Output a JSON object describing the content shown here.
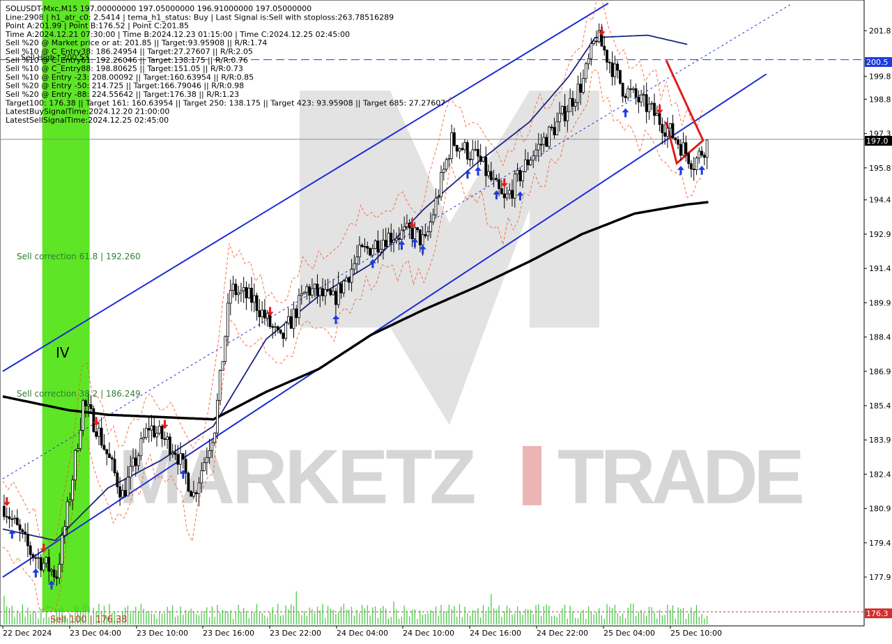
{
  "header": {
    "lines": [
      "SOLUSDT-Mxc,M15  197.00000000 197.05000000 196.91000000 197.05000000",
      "Line:2908 | h1_atr_c0: 2.5414 | tema_h1_status: Buy | Last Signal is:Sell with stoploss:263.78516289",
      "Point A:201.99 | Point B:176.52 | Point C:201.85",
      "Time A:2024.12.21 07:30:00 | Time B:2024.12.23 01:15:00 | Time C:2024.12.25 02:45:00",
      "Sell %20 @ Market price or at: 201.85 || Target:93.95908 || R/R:1.74",
      "Sell %10 @ C_Entry38: 186.24954 || Target:27.27607 || R/R:2.05",
      "Sell %10 @ C_Entry61: 192.26046 || Target:138.175 || R/R:0.76",
      "Sell %10 @ C_Entry88: 198.80625 || Target:151.05 || R/R:0.73",
      "Sell %10 @ Entry -23: 208.00092 || Target:160.63954 || R/R:0.85",
      "Sell %20 @ Entry -50: 214.725 || Target:166.79046 || R/R:0.98",
      "Sell %20 @ Entry -88: 224.55642 || Target:176.38 || R/R:1.23",
      "Target100: 176.38 || Target 161: 160.63954 || Target 250: 138.175 || Target 423: 93.95908 || Target 685: 27.27607",
      "LatestBuySignalTime:2024.12.20 21:00:00",
      "LatestSellSignalTime:2024.12.25 02:45:00"
    ],
    "overlay_text": "Sell High | 200.53"
  },
  "annotations": {
    "sell_correction_618": "Sell correction 61.8 | 192.260",
    "sell_correction_382": "Sell correction 38.2 | 186.249",
    "sell_100": "Sell 100 | 176.38",
    "wave_label": "IV",
    "watermark_left": "MARKETZ",
    "watermark_right": "TRADE"
  },
  "price_labels": {
    "current": "197.0",
    "high_line": "200.5",
    "bottom_line": "176.3"
  },
  "chart_data": {
    "type": "candlestick",
    "symbol": "SOLUSDT-Mxc",
    "timeframe": "M15",
    "ylim": [
      176.0,
      202.5
    ],
    "y_ticks": [
      "201.8",
      "199.8",
      "198.8",
      "197.3",
      "195.8",
      "194.4",
      "192.9",
      "191.4",
      "189.9",
      "188.4",
      "186.9",
      "185.4",
      "183.9",
      "182.4",
      "180.9",
      "179.4",
      "177.9"
    ],
    "y_tick_values": [
      201.8,
      199.8,
      198.8,
      197.3,
      195.8,
      194.4,
      192.9,
      191.4,
      189.9,
      188.4,
      186.9,
      185.4,
      183.9,
      182.4,
      180.9,
      179.4,
      177.9
    ],
    "x_ticks": [
      "22 Dec 2024",
      "23 Dec 04:00",
      "23 Dec 10:00",
      "23 Dec 16:00",
      "23 Dec 22:00",
      "24 Dec 04:00",
      "24 Dec 10:00",
      "24 Dec 16:00",
      "24 Dec 22:00",
      "25 Dec 04:00",
      "25 Dec 10:00"
    ],
    "close_anchors": [
      [
        0,
        181.0
      ],
      [
        10,
        179.0
      ],
      [
        20,
        178.0
      ],
      [
        25,
        181.5
      ],
      [
        30,
        185.5
      ],
      [
        35,
        184.5
      ],
      [
        45,
        181.5
      ],
      [
        55,
        184.5
      ],
      [
        65,
        183.5
      ],
      [
        72,
        181.5
      ],
      [
        80,
        184.5
      ],
      [
        86,
        190.5
      ],
      [
        95,
        190.0
      ],
      [
        105,
        188.2
      ],
      [
        115,
        190.5
      ],
      [
        125,
        190.0
      ],
      [
        135,
        192.0
      ],
      [
        145,
        192.8
      ],
      [
        155,
        193.0
      ],
      [
        160,
        192.5
      ],
      [
        170,
        197.0
      ],
      [
        180,
        196.2
      ],
      [
        190,
        194.3
      ],
      [
        200,
        196.3
      ],
      [
        210,
        197.7
      ],
      [
        220,
        199.6
      ],
      [
        225,
        201.6
      ],
      [
        235,
        199.3
      ],
      [
        245,
        198.4
      ],
      [
        255,
        197.1
      ],
      [
        262,
        196.0
      ],
      [
        268,
        197.05
      ]
    ],
    "current_price": 197.05,
    "sell_high_level": 200.53,
    "bottom_level": 176.38,
    "ma_fast_anchors": [
      [
        0,
        180.0
      ],
      [
        20,
        179.5
      ],
      [
        40,
        181.8
      ],
      [
        60,
        183.0
      ],
      [
        80,
        184.5
      ],
      [
        100,
        188.3
      ],
      [
        120,
        190.2
      ],
      [
        140,
        191.6
      ],
      [
        160,
        194.0
      ],
      [
        180,
        196.0
      ],
      [
        200,
        197.8
      ],
      [
        215,
        199.8
      ],
      [
        225,
        201.5
      ],
      [
        245,
        201.6
      ],
      [
        260,
        201.2
      ]
    ],
    "ma_slow_anchors": [
      [
        0,
        185.8
      ],
      [
        25,
        185.2
      ],
      [
        40,
        185.0
      ],
      [
        60,
        184.9
      ],
      [
        80,
        184.8
      ],
      [
        100,
        186.0
      ],
      [
        120,
        187.0
      ],
      [
        140,
        188.5
      ],
      [
        160,
        189.6
      ],
      [
        180,
        190.6
      ],
      [
        200,
        191.7
      ],
      [
        220,
        192.9
      ],
      [
        240,
        193.8
      ],
      [
        260,
        194.2
      ],
      [
        268,
        194.3
      ]
    ],
    "channel": {
      "upper_line": [
        [
          0,
          186.9
        ],
        [
          230,
          203.0
        ]
      ],
      "lower_line": [
        [
          0,
          177.9
        ],
        [
          290,
          199.9
        ]
      ],
      "mid_line": [
        [
          0,
          182.2
        ],
        [
          300,
          203.0
        ]
      ]
    },
    "red_zigzag": [
      [
        252,
        200.5
      ],
      [
        266,
        197.0
      ],
      [
        256,
        196.0
      ],
      [
        252,
        197.8
      ]
    ],
    "green_zone": {
      "from_bar": 15,
      "to_bar": 33
    },
    "grid": false,
    "legend": "none"
  }
}
